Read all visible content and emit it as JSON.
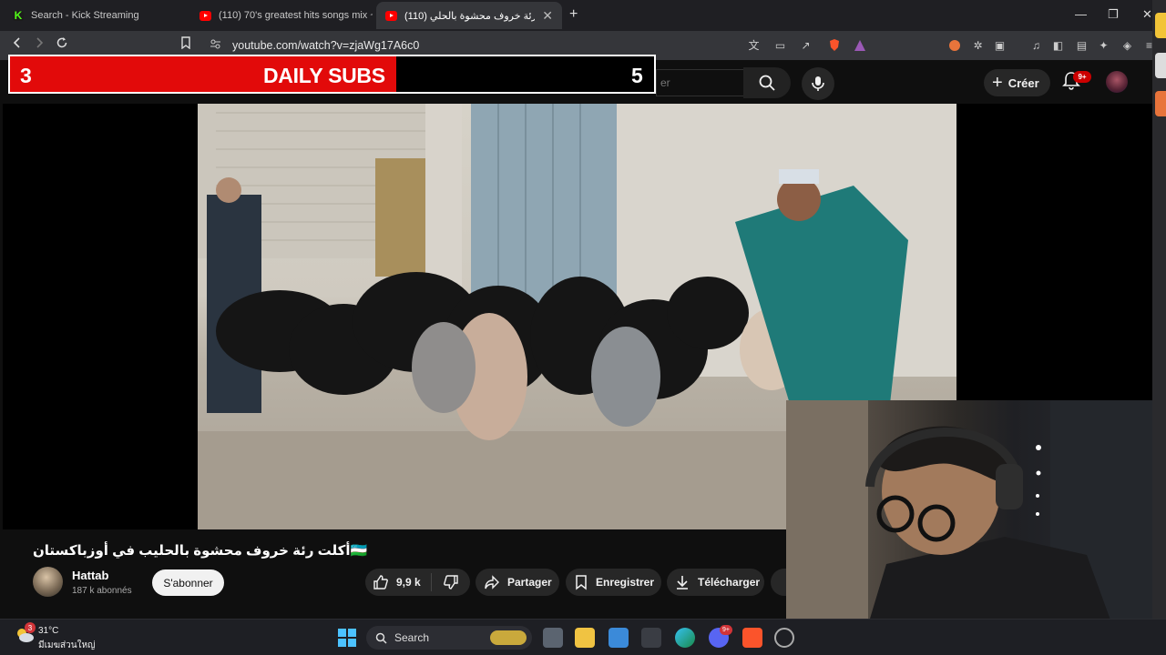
{
  "browser": {
    "tabs": [
      {
        "title": "Search - Kick Streaming",
        "favicon": "kick-icon"
      },
      {
        "title": "(110) 70's greatest hits songs mix ~m",
        "favicon": "youtube-icon"
      },
      {
        "title": "(110) أكلت رئة خروف محشوة بالحلي",
        "favicon": "youtube-icon"
      }
    ],
    "new_tab_label": "+",
    "url": "youtube.com/watch?v=zjaWg17A6c0"
  },
  "youtube": {
    "search_placeholder": "er",
    "create_label": "Créer",
    "notifications_badge": "9+"
  },
  "overlay": {
    "left_value": "3",
    "title": "DAILY SUBS",
    "right_value": "5",
    "fill_fraction": 0.6
  },
  "video": {
    "title": "أكلت رئة خروف محشوة بالحليب في أوزباكستان🇺🇿",
    "channel_name": "Hattab",
    "channel_subs": "187 k abonnés",
    "subscribe_label": "S'abonner",
    "like_count": "9,9 k",
    "share_label": "Partager",
    "save_label": "Enregistrer",
    "download_label": "Télécharger"
  },
  "taskbar": {
    "weather_temp": "31°C",
    "weather_desc": "มีเมฆส่วนใหญ่",
    "weather_badge": "3",
    "search_label": "Search",
    "discord_badge": "9+"
  },
  "colors": {
    "accent_red": "#e20a0a",
    "youtube_red": "#ff0000",
    "kick_green": "#53fc18"
  }
}
